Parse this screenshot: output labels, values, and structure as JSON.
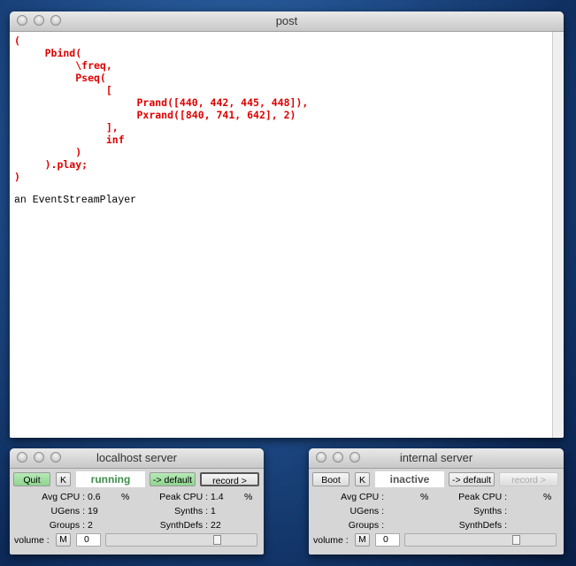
{
  "post": {
    "title": "post",
    "code": "(\n     Pbind(\n          \\freq,\n          Pseq(\n               [\n                    Prand([440, 442, 445, 448]),\n                    Pxrand([840, 741, 642], 2)\n               ],\n               inf\n          )\n     ).play;\n)",
    "output": "an EventStreamPlayer"
  },
  "servers": [
    {
      "title": "localhost server",
      "boot_label": "Quit",
      "kill_label": "K",
      "status": "running",
      "default_label": "-> default",
      "record_label": "record >",
      "avg_cpu_label": "Avg CPU :",
      "avg_cpu": "0.6",
      "pct": "%",
      "peak_cpu_label": "Peak CPU :",
      "peak_cpu": "1.4",
      "ugens_label": "UGens :",
      "ugens": "19",
      "synths_label": "Synths :",
      "synths": "1",
      "groups_label": "Groups :",
      "groups": "2",
      "synthdefs_label": "SynthDefs :",
      "synthdefs": "22",
      "volume_label": "volume :",
      "mute_label": "M",
      "volume": "0",
      "volume_slider": 0.75
    },
    {
      "title": "internal server",
      "boot_label": "Boot",
      "kill_label": "K",
      "status": "inactive",
      "default_label": "-> default",
      "record_label": "record >",
      "avg_cpu_label": "Avg CPU :",
      "avg_cpu": "",
      "pct": "%",
      "peak_cpu_label": "Peak CPU :",
      "peak_cpu": "",
      "ugens_label": "UGens :",
      "ugens": "",
      "synths_label": "Synths :",
      "synths": "",
      "groups_label": "Groups :",
      "groups": "",
      "synthdefs_label": "SynthDefs :",
      "synthdefs": "",
      "volume_label": "volume :",
      "mute_label": "M",
      "volume": "0",
      "volume_slider": 0.75
    }
  ]
}
